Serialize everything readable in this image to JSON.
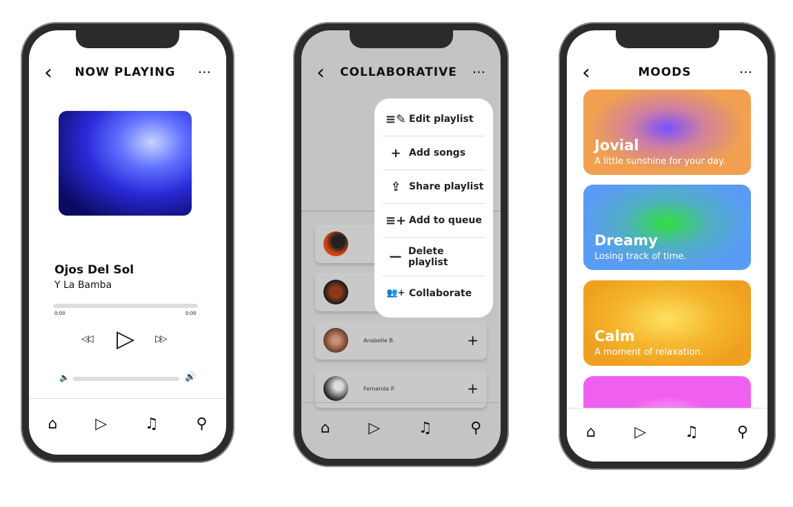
{
  "now_playing": {
    "title": "NOW PLAYING",
    "song": "Ojos Del Sol",
    "artist": "Y La Bamba",
    "elapsed": "0:00",
    "duration": "0:00",
    "progress": 0,
    "volume": 0
  },
  "collaborative": {
    "title": "COLLABORATIVE",
    "menu": [
      {
        "icon": "edit-list-icon",
        "glyph": "≡✎",
        "label": "Edit playlist"
      },
      {
        "icon": "plus-icon",
        "glyph": "+",
        "label": "Add songs"
      },
      {
        "icon": "share-icon",
        "glyph": "⇪",
        "label": "Share playlist"
      },
      {
        "icon": "queue-add-icon",
        "glyph": "≡+",
        "label": "Add to queue"
      },
      {
        "icon": "minus-icon",
        "glyph": "—",
        "label": "Delete playlist"
      },
      {
        "icon": "add-user-icon",
        "glyph": "👥+",
        "label": "Collaborate"
      }
    ],
    "users": [
      {
        "name": "Anabelle B."
      },
      {
        "name": "Fernanda P."
      }
    ]
  },
  "moods": {
    "title": "MOODS",
    "cards": [
      {
        "title": "Jovial",
        "subtitle": "A little sunshine for your day."
      },
      {
        "title": "Dreamy",
        "subtitle": "Losing track of time."
      },
      {
        "title": "Calm",
        "subtitle": "A moment of relaxation."
      }
    ]
  },
  "glyphs": {
    "back": "‹",
    "more": "···",
    "home": "⌂",
    "play": "▷",
    "music": "♫",
    "search": "⚲",
    "rewind": "◁◁",
    "forward": "▷▷",
    "vol_low": "🔈",
    "vol_high": "🔊",
    "plus": "+"
  }
}
